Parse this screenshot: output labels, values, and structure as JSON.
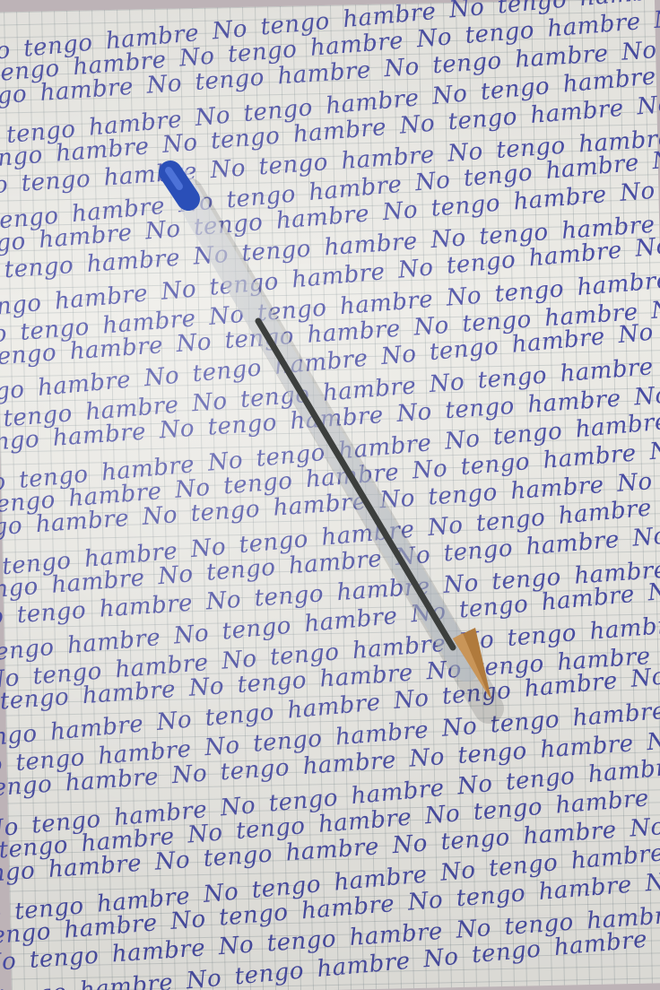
{
  "handwriting": {
    "phrase": "No tengo hambre",
    "line_count": 34
  },
  "colors": {
    "ink": "#3a3fa0",
    "paper": "#ecebe6",
    "grid": "#8a9aa0",
    "pen_cap": "#2a4fb8",
    "pen_tip": "#b07a3c"
  }
}
